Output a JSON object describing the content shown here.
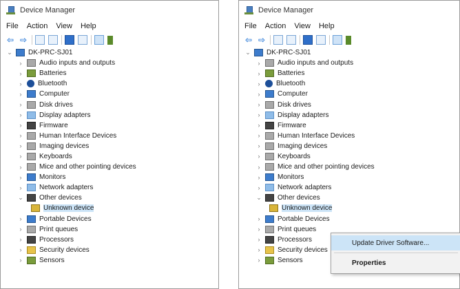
{
  "title": "Device Manager",
  "menu": [
    "File",
    "Action",
    "View",
    "Help"
  ],
  "computer": "DK-PRC-SJ01",
  "categories": [
    {
      "label": "Audio inputs and outputs",
      "icon": "speaker-icon",
      "color": "gray"
    },
    {
      "label": "Batteries",
      "icon": "battery-icon",
      "color": "green"
    },
    {
      "label": "Bluetooth",
      "icon": "bluetooth-icon",
      "color": "bt"
    },
    {
      "label": "Computer",
      "icon": "monitor-icon",
      "color": "blue"
    },
    {
      "label": "Disk drives",
      "icon": "disk-drive-icon",
      "color": "gray"
    },
    {
      "label": "Display adapters",
      "icon": "display-adapter-icon",
      "color": "lblue"
    },
    {
      "label": "Firmware",
      "icon": "chip-icon",
      "color": "dark"
    },
    {
      "label": "Human Interface Devices",
      "icon": "hid-icon",
      "color": "gray"
    },
    {
      "label": "Imaging devices",
      "icon": "camera-icon",
      "color": "gray"
    },
    {
      "label": "Keyboards",
      "icon": "keyboard-icon",
      "color": "gray"
    },
    {
      "label": "Mice and other pointing devices",
      "icon": "mouse-icon",
      "color": "gray"
    },
    {
      "label": "Monitors",
      "icon": "monitor-icon",
      "color": "blue"
    },
    {
      "label": "Network adapters",
      "icon": "network-icon",
      "color": "lblue"
    }
  ],
  "other_devices": {
    "label": "Other devices",
    "child": "Unknown device"
  },
  "after": [
    {
      "label": "Portable Devices",
      "icon": "portable-device-icon",
      "color": "blue"
    },
    {
      "label": "Print queues",
      "icon": "printer-icon",
      "color": "gray"
    },
    {
      "label": "Processors",
      "icon": "cpu-icon",
      "color": "dark"
    },
    {
      "label": "Security devices",
      "icon": "security-icon",
      "color": "yellow"
    },
    {
      "label": "Sensors",
      "icon": "sensor-icon",
      "color": "green"
    }
  ],
  "context_menu": {
    "update": "Update Driver Software...",
    "properties": "Properties"
  },
  "colors": {
    "selection": "#cce4f7",
    "accent": "#2b7bd8"
  }
}
